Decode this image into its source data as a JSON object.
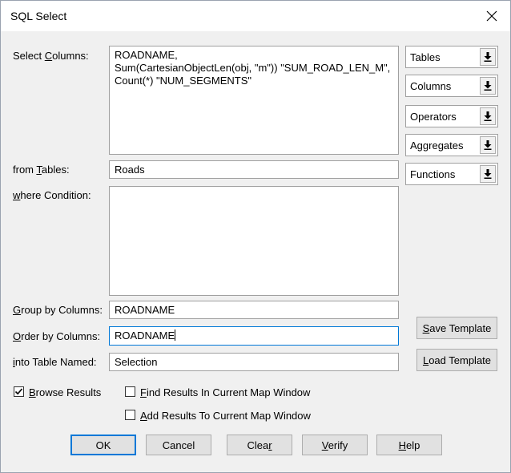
{
  "window": {
    "title": "SQL Select"
  },
  "labels": {
    "select_columns": "Select Columns:",
    "from_tables": "from Tables:",
    "where_condition": "where Condition:",
    "group_by": "Group by Columns:",
    "order_by": "Order by Columns:",
    "into_table": "into Table Named:"
  },
  "fields": {
    "select_columns": "ROADNAME,\nSum(CartesianObjectLen(obj, \"m\")) \"SUM_ROAD_LEN_M\",\nCount(*) \"NUM_SEGMENTS\"",
    "from_tables": "Roads",
    "where_condition": "",
    "group_by": "ROADNAME",
    "order_by": "ROADNAME",
    "into_table": "Selection"
  },
  "combos": [
    "Tables",
    "Columns",
    "Operators",
    "Aggregates",
    "Functions"
  ],
  "side_buttons": {
    "save_template": "Save Template",
    "load_template": "Load Template"
  },
  "checkboxes": {
    "browse_results": {
      "label": "Browse Results",
      "checked": true
    },
    "find_results": {
      "label": "Find Results In Current Map Window",
      "checked": false
    },
    "add_results": {
      "label": "Add Results To Current Map Window",
      "checked": false
    }
  },
  "buttons": {
    "ok": "OK",
    "cancel": "Cancel",
    "clear": "Clear",
    "verify": "Verify",
    "help": "Help"
  }
}
